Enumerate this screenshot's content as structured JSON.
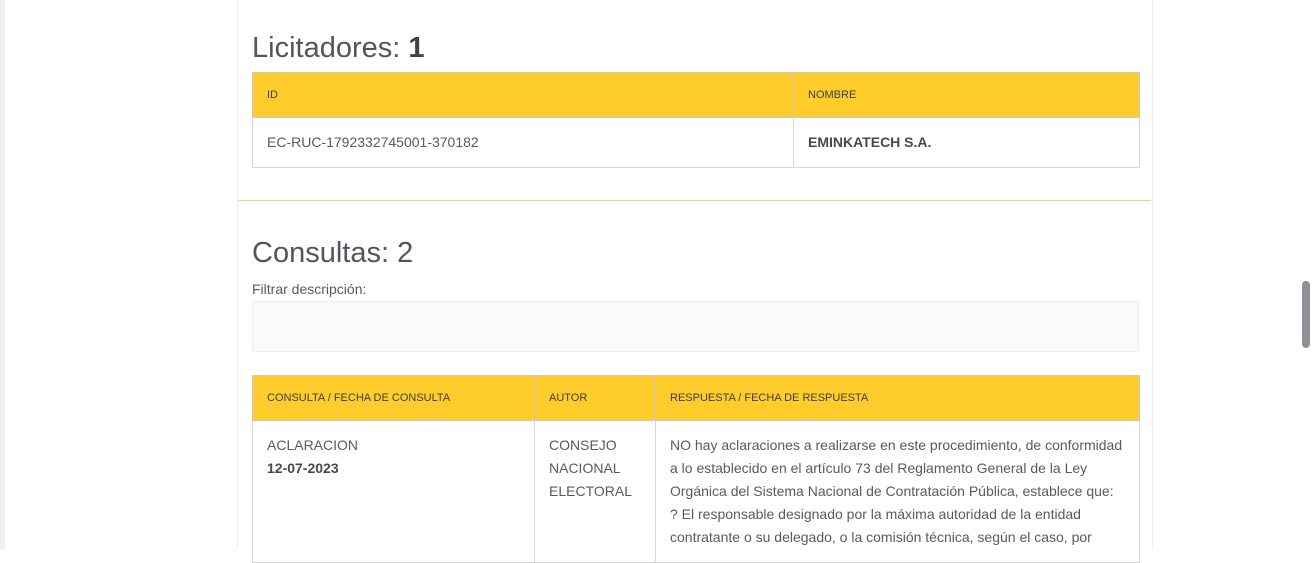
{
  "licitadores": {
    "title": "Licitadores:",
    "count": "1",
    "columns": [
      "ID",
      "NOMBRE"
    ],
    "rows": [
      {
        "id": "EC-RUC-1792332745001-370182",
        "nombre": "EMINKATECH S.A."
      }
    ]
  },
  "consultas": {
    "title": "Consultas:",
    "count": "2",
    "filter_label": "Filtrar descripción:",
    "filter_value": "",
    "columns": [
      "CONSULTA / FECHA DE CONSULTA",
      "AUTOR",
      "RESPUESTA / FECHA DE RESPUESTA"
    ],
    "rows": [
      {
        "consulta": "ACLARACION",
        "fecha": "12-07-2023",
        "autor_lines": [
          "CONSEJO",
          "NACIONAL",
          "ELECTORAL"
        ],
        "respuesta": "NO hay aclaraciones a realizarse en este procedimiento, de conformidad a lo establecido en el artículo 73 del Reglamento General de la Ley Orgánica del Sistema Nacional de Contratación Pública, establece que: ? El responsable designado por la máxima autoridad de la entidad contratante o su delegado, o la comisión técnica, según el caso, por"
      }
    ]
  }
}
